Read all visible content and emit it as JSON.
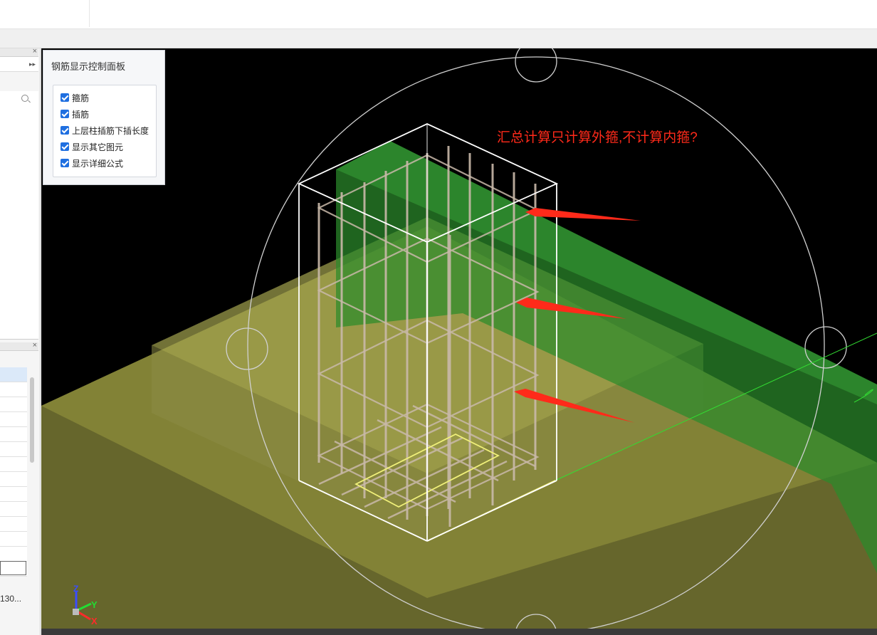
{
  "panel": {
    "title": "钢筋显示控制面板",
    "options": [
      {
        "label": "箍筋",
        "checked": true
      },
      {
        "label": "插筋",
        "checked": true
      },
      {
        "label": "上层柱插筋下插长度",
        "checked": true
      },
      {
        "label": "显示其它图元",
        "checked": true
      },
      {
        "label": "显示详细公式",
        "checked": true
      }
    ]
  },
  "annotation": {
    "text": "汇总计算只计算外箍,不计算内箍?",
    "color": "#ff2a1a"
  },
  "left_panel": {
    "cell_text": "130..."
  },
  "axes": {
    "z": "Z",
    "y": "Y",
    "x": "X"
  },
  "colors": {
    "viewport_bg": "#000000",
    "slab": "#8a8a3a",
    "beam": "#2f8f2f",
    "rebar": "#c9b9a9",
    "stirrup_bottom": "#f0f07a",
    "arrow": "#ff2a1a",
    "checkbox": "#1f6fe0"
  }
}
